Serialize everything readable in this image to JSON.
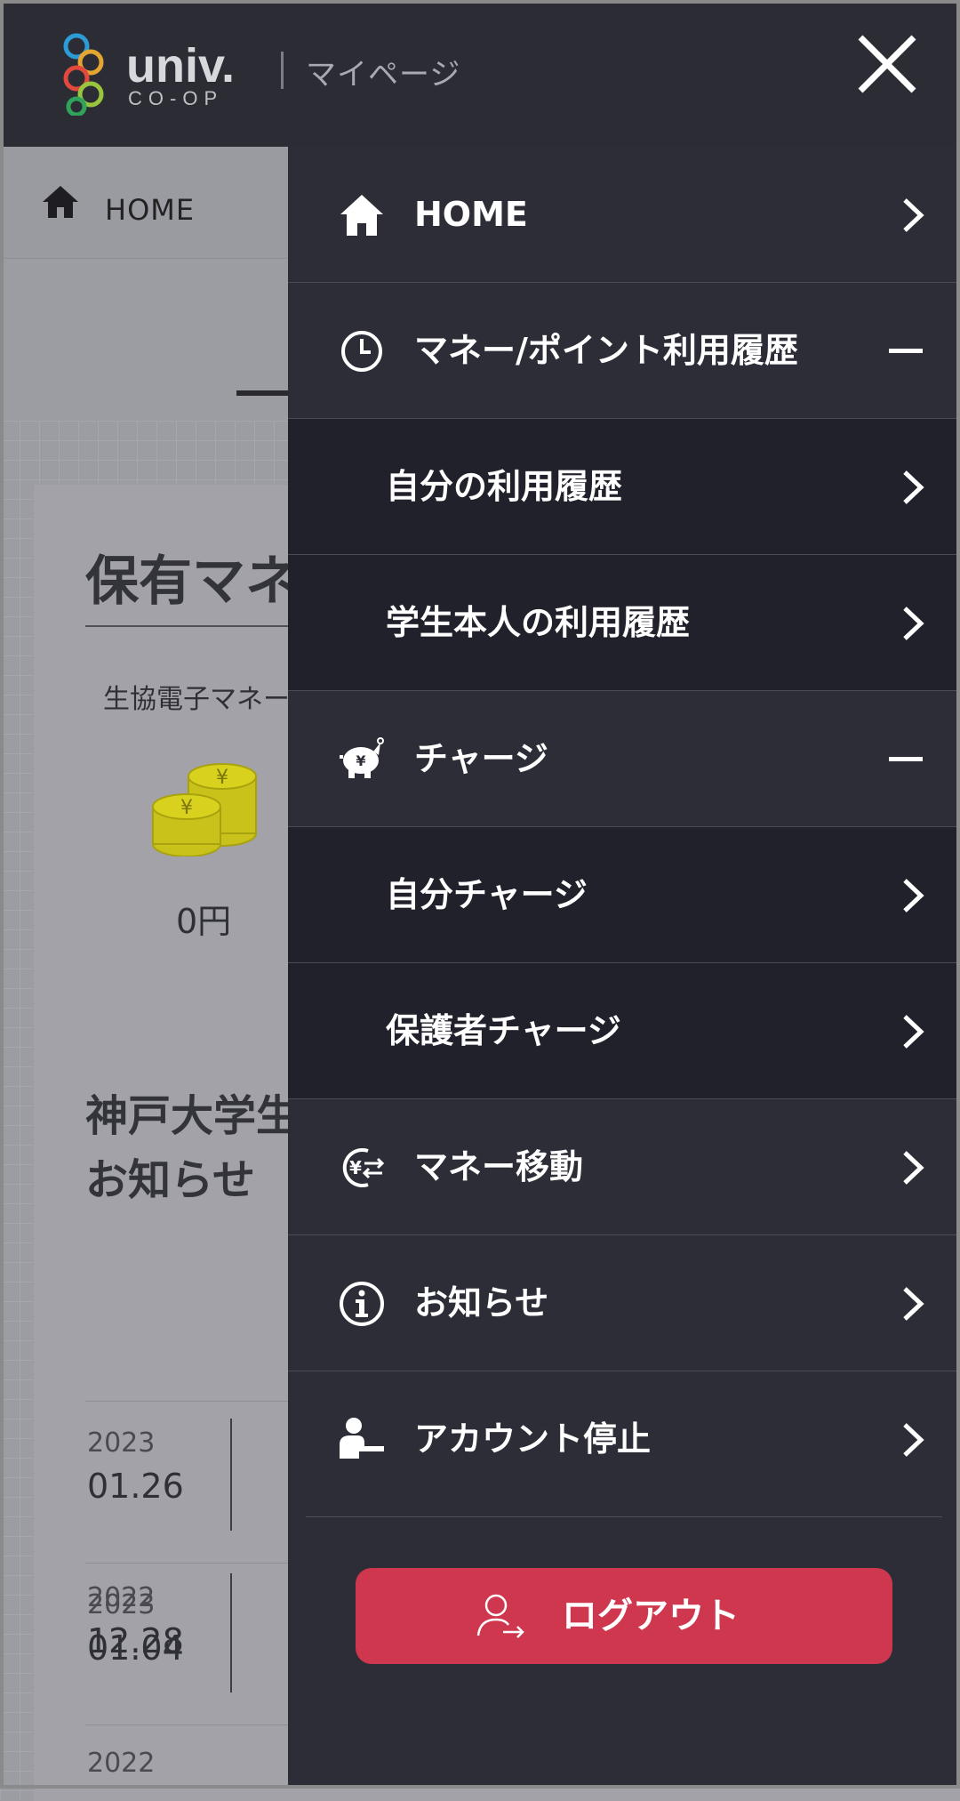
{
  "header": {
    "logo_text": "univ.",
    "logo_sub": "CO-OP",
    "title": "マイページ"
  },
  "background": {
    "home_label": "HOME",
    "heading": "保有マネ",
    "money_label": "生協電子マネー",
    "amount": "0円",
    "news_title_line1": "神戸大学生",
    "news_title_line2": "お知らせ",
    "news": [
      {
        "year": "2023",
        "date": "01.26"
      },
      {
        "year": "2023",
        "date": "01.04"
      },
      {
        "year": "2022",
        "date": "12.28"
      },
      {
        "year": "2022",
        "date": ""
      }
    ]
  },
  "menu": {
    "home": "HOME",
    "history": "マネー/ポイント利用履歴",
    "history_self": "自分の利用履歴",
    "history_student": "学生本人の利用履歴",
    "charge": "チャージ",
    "charge_self": "自分チャージ",
    "charge_guardian": "保護者チャージ",
    "money_transfer": "マネー移動",
    "news": "お知らせ",
    "account_stop": "アカウント停止",
    "logout": "ログアウト"
  },
  "colors": {
    "header_bg": "#2b2c34",
    "drawer_bg": "#2c2d36",
    "submenu_bg": "#20212a",
    "logout_bg": "#cf374f"
  }
}
